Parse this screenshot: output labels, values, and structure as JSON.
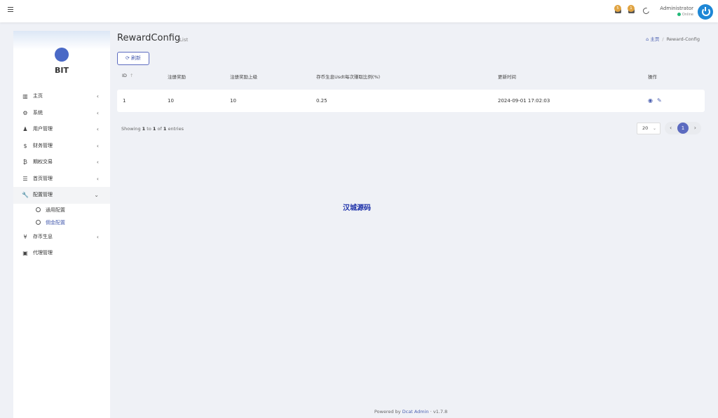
{
  "topbar": {
    "notifications": [
      {
        "count": "5"
      },
      {
        "count": "1"
      }
    ],
    "user": {
      "name": "Administrator",
      "status": "Online"
    }
  },
  "sidebar": {
    "brand": "BIT",
    "items": [
      {
        "label": "主页",
        "icon": "bar-chart-icon"
      },
      {
        "label": "系统",
        "icon": "gear-icon"
      },
      {
        "label": "用户管理",
        "icon": "users-icon"
      },
      {
        "label": "财务管理",
        "icon": "dollar-icon"
      },
      {
        "label": "期权交易",
        "icon": "bitcoin-icon"
      },
      {
        "label": "首页管理",
        "icon": "list-icon"
      },
      {
        "label": "配置管理",
        "icon": "wrench-icon"
      },
      {
        "label": "存币生息",
        "icon": "yen-icon"
      },
      {
        "label": "代理管理",
        "icon": "id-card-icon"
      }
    ],
    "subitems": [
      {
        "label": "通用配置"
      },
      {
        "label": "佣金配置"
      }
    ]
  },
  "header": {
    "title": "RewardConfig",
    "subtitle": "List",
    "breadcrumb": {
      "home": "主页",
      "current": "Reward-Config"
    }
  },
  "toolbar": {
    "refresh_label": "刷新"
  },
  "table": {
    "columns": [
      "ID",
      "注册奖励",
      "注册奖励上级",
      "存币生息Usdt每次赚取比例(%)",
      "更新时间",
      "操作"
    ],
    "rows": [
      {
        "id": "1",
        "reg_reward": "10",
        "reg_reward_parent": "10",
        "ratio": "0.25",
        "updated": "2024-09-01 17:02:03"
      }
    ]
  },
  "pagination": {
    "showing_prefix": "Showing",
    "from": "1",
    "to_word": "to",
    "to": "1",
    "of_word": "of",
    "total": "1",
    "entries_word": "entries",
    "page_size": "20",
    "current_page": "1"
  },
  "watermark": "汉城源码",
  "footer": {
    "prefix": "Powered by",
    "link": "Dcat Admin",
    "version": "v1.7.8"
  },
  "colors": {
    "accent": "#5c6bc0",
    "online": "#21b978",
    "badge": "#e0a341",
    "avatar": "#1e87d6"
  }
}
